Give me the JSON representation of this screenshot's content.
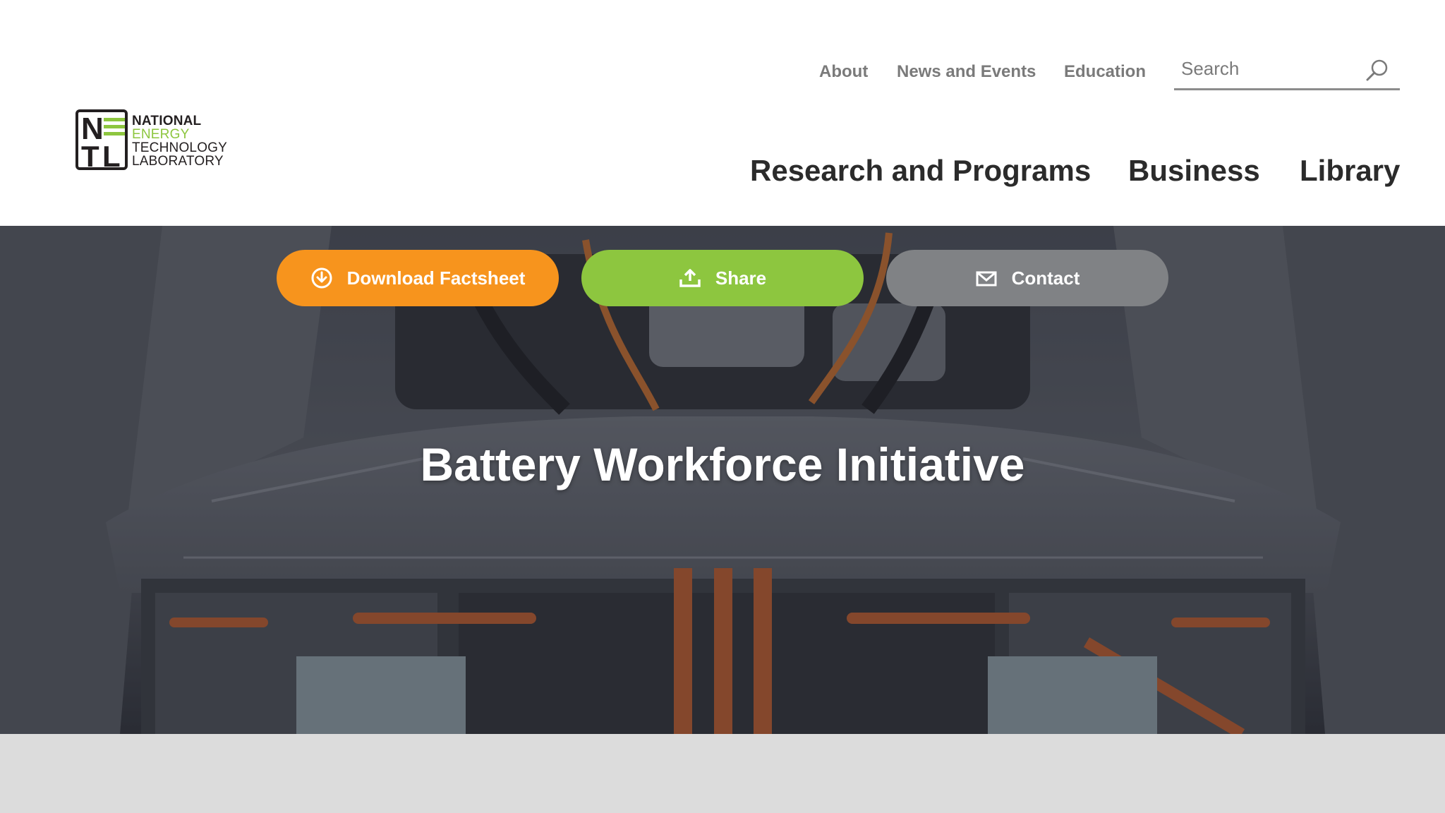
{
  "logo": {
    "letters": {
      "n": "N",
      "t": "T",
      "l": "L"
    },
    "lines": [
      "NATIONAL",
      "ENERGY",
      "TECHNOLOGY",
      "LABORATORY"
    ],
    "accent_color": "#8dc63f"
  },
  "utility_nav": {
    "items": [
      {
        "label": "About"
      },
      {
        "label": "News and Events"
      },
      {
        "label": "Education"
      }
    ]
  },
  "search": {
    "placeholder": "Search",
    "icon": "search-icon"
  },
  "main_nav": {
    "items": [
      {
        "label": "Research and Programs"
      },
      {
        "label": "Business"
      },
      {
        "label": "Library"
      }
    ]
  },
  "hero": {
    "title": "Battery Workforce Initiative",
    "buttons": [
      {
        "label": "Download Factsheet",
        "icon": "download-circle-icon",
        "color": "#f7941d"
      },
      {
        "label": "Share",
        "icon": "upload-share-icon",
        "color": "#8dc63f"
      },
      {
        "label": "Contact",
        "icon": "envelope-icon",
        "color": "#808285"
      }
    ]
  },
  "colors": {
    "text_dark": "#2b2b2b",
    "text_muted": "#7a7a7a",
    "footer_bg": "#dcdcdc"
  }
}
